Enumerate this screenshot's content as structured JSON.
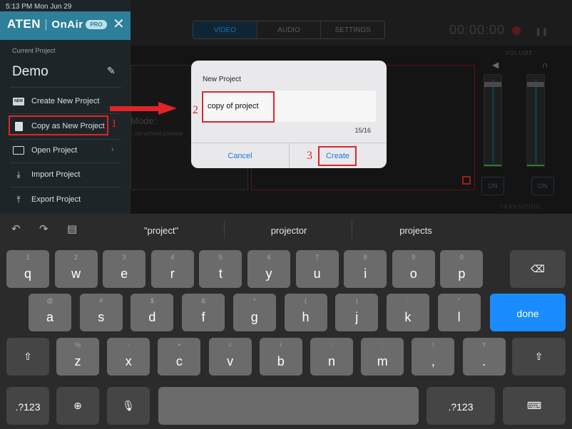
{
  "status_bar": {
    "time": "5:13 PM  Mon Jun 29"
  },
  "sidebar": {
    "brand": "ATEN",
    "brand_sep": "|",
    "brand_app": "OnAir",
    "pro_badge": "PRO",
    "close_glyph": "✕",
    "current_project_label": "Current Project",
    "project_name": "Demo",
    "items": [
      {
        "label": "Create New Project",
        "icon": "new-badge-icon",
        "badge": "NEW"
      },
      {
        "label": "Copy as New Project",
        "icon": "copy-icon"
      },
      {
        "label": "Open Project",
        "icon": "folder-icon"
      },
      {
        "label": "Import Project",
        "icon": "import-icon"
      },
      {
        "label": "Export Project",
        "icon": "export-icon"
      }
    ]
  },
  "app_bg": {
    "tabs": [
      "VIDEO",
      "AUDIO",
      "SETTINGS"
    ],
    "timer": "00:00:00",
    "volume_label": "VOLUME",
    "transition_label": "TRANSITION",
    "on_labels": [
      "ON",
      "ON"
    ],
    "mode_text": "Mode:",
    "mode_sub": "...rm without preview"
  },
  "annotations": {
    "step1": "1",
    "step2": "2",
    "step3": "3",
    "accent": "#e0242a"
  },
  "dialog": {
    "title": "New Project",
    "input_value": "copy of project",
    "char_count": "15/16",
    "cancel_label": "Cancel",
    "create_label": "Create"
  },
  "keyboard": {
    "suggestions": [
      "\"project\"",
      "projector",
      "projects"
    ],
    "row1": [
      {
        "k": "q",
        "s": "1"
      },
      {
        "k": "w",
        "s": "2"
      },
      {
        "k": "e",
        "s": "3"
      },
      {
        "k": "r",
        "s": "4"
      },
      {
        "k": "t",
        "s": "5"
      },
      {
        "k": "y",
        "s": "6"
      },
      {
        "k": "u",
        "s": "7"
      },
      {
        "k": "i",
        "s": "8"
      },
      {
        "k": "o",
        "s": "9"
      },
      {
        "k": "p",
        "s": "0"
      }
    ],
    "row2": [
      {
        "k": "a",
        "s": "@"
      },
      {
        "k": "s",
        "s": "#"
      },
      {
        "k": "d",
        "s": "$"
      },
      {
        "k": "f",
        "s": "&"
      },
      {
        "k": "g",
        "s": "*"
      },
      {
        "k": "h",
        "s": "("
      },
      {
        "k": "j",
        "s": ")"
      },
      {
        "k": "k",
        "s": "'"
      },
      {
        "k": "l",
        "s": "\""
      }
    ],
    "row3": [
      {
        "k": "z",
        "s": "%"
      },
      {
        "k": "x",
        "s": "-"
      },
      {
        "k": "c",
        "s": "+"
      },
      {
        "k": "v",
        "s": "="
      },
      {
        "k": "b",
        "s": "/"
      },
      {
        "k": "n",
        "s": ";"
      },
      {
        "k": "m",
        "s": ":"
      },
      {
        "k": ",",
        "s": "!"
      },
      {
        "k": ".",
        "s": "?"
      }
    ],
    "done_label": "done",
    "numbers_label": ".?123",
    "colors": {
      "key": "#6b6b6b",
      "dark_key": "#454545",
      "done": "#1a8cff"
    }
  }
}
